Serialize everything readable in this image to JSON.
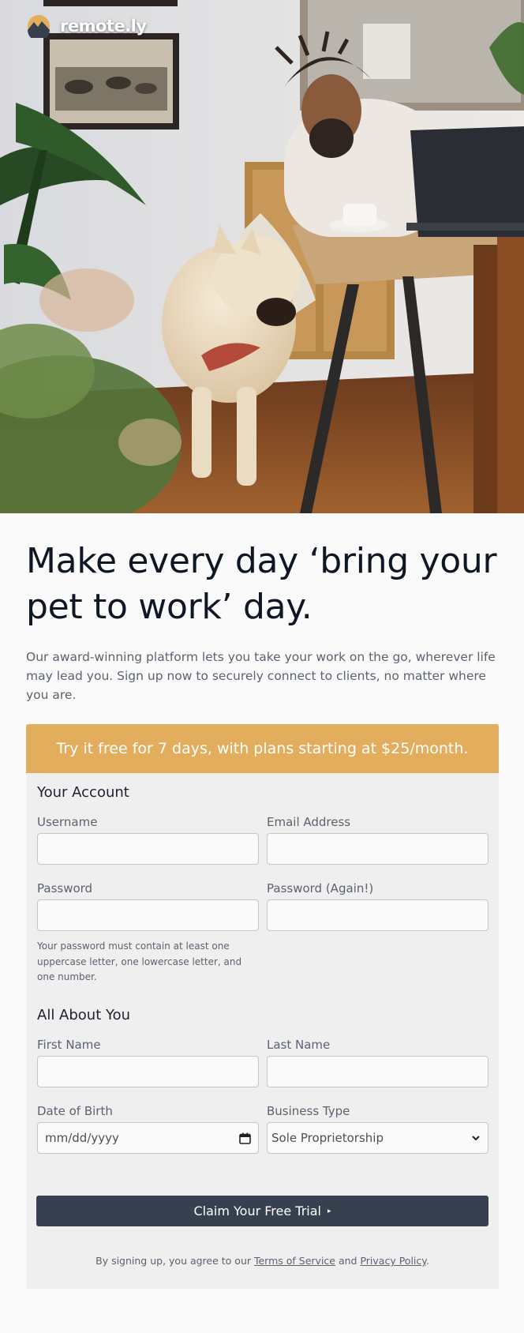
{
  "brand": {
    "name": "remote.ly",
    "logo_icon": "mountain-sun-icon"
  },
  "hero": {
    "headline": "Make every day ‘bring your pet to work’ day.",
    "intro": "Our award-winning platform lets you take your work on the go, wherever life may lead you. Sign up now to securely connect to clients, no matter where you are."
  },
  "signup": {
    "banner": "Try it free for 7 days, with plans starting at $25/month.",
    "account_section": {
      "title": "Your Account",
      "username_label": "Username",
      "email_label": "Email Address",
      "password_label": "Password",
      "password_again_label": "Password (Again!)",
      "password_help": "Your password must contain at least one uppercase letter, one lowercase letter, and one number."
    },
    "about_section": {
      "title": "All About You",
      "first_name_label": "First Name",
      "last_name_label": "Last Name",
      "dob_label": "Date of Birth",
      "dob_placeholder": "mm/dd/yyyy",
      "business_type_label": "Business Type",
      "business_type_value": "Sole Proprietorship"
    },
    "submit_label": "Claim Your Free Trial",
    "submit_arrow": "▸",
    "terms": {
      "prefix": "By signing up, you agree to our ",
      "tos_link": "Terms of Service",
      "middle": " and ",
      "privacy_link": "Privacy Policy",
      "suffix": "."
    }
  },
  "colors": {
    "accent": "#e2ad5c",
    "button": "#37404f",
    "heading": "#0f1624",
    "body_text": "#5b6270"
  }
}
